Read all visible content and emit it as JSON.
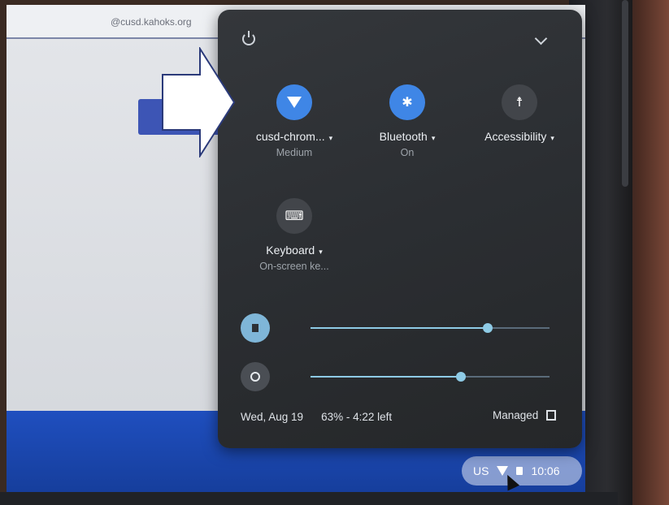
{
  "browser": {
    "email_hint": "@cusd.kahoks.org"
  },
  "quick_settings": {
    "tiles": [
      {
        "id": "network",
        "label": "cusd-chrom...",
        "sub": "Medium",
        "state": "on",
        "icon": "wifi-icon"
      },
      {
        "id": "bluetooth",
        "label": "Bluetooth",
        "sub": "On",
        "state": "on",
        "icon": "bluetooth-icon"
      },
      {
        "id": "accessibility",
        "label": "Accessibility",
        "sub": "",
        "state": "off",
        "icon": "accessibility-icon"
      },
      {
        "id": "keyboard",
        "label": "Keyboard",
        "sub": "On-screen ke...",
        "state": "off",
        "icon": "keyboard-icon"
      }
    ],
    "volume": {
      "icon": "speaker-icon",
      "level": 0.74
    },
    "brightness": {
      "icon": "brightness-icon",
      "level": 0.63
    },
    "footer": {
      "date": "Wed, Aug 19",
      "battery": "63% - 4:22 left",
      "managed": "Managed"
    }
  },
  "shelf": {
    "input_method": "US",
    "time": "10:06"
  },
  "colors": {
    "accent_blue": "#3f86e6",
    "slider": "#8ecbe6",
    "shelf": "#1f4fbf"
  }
}
